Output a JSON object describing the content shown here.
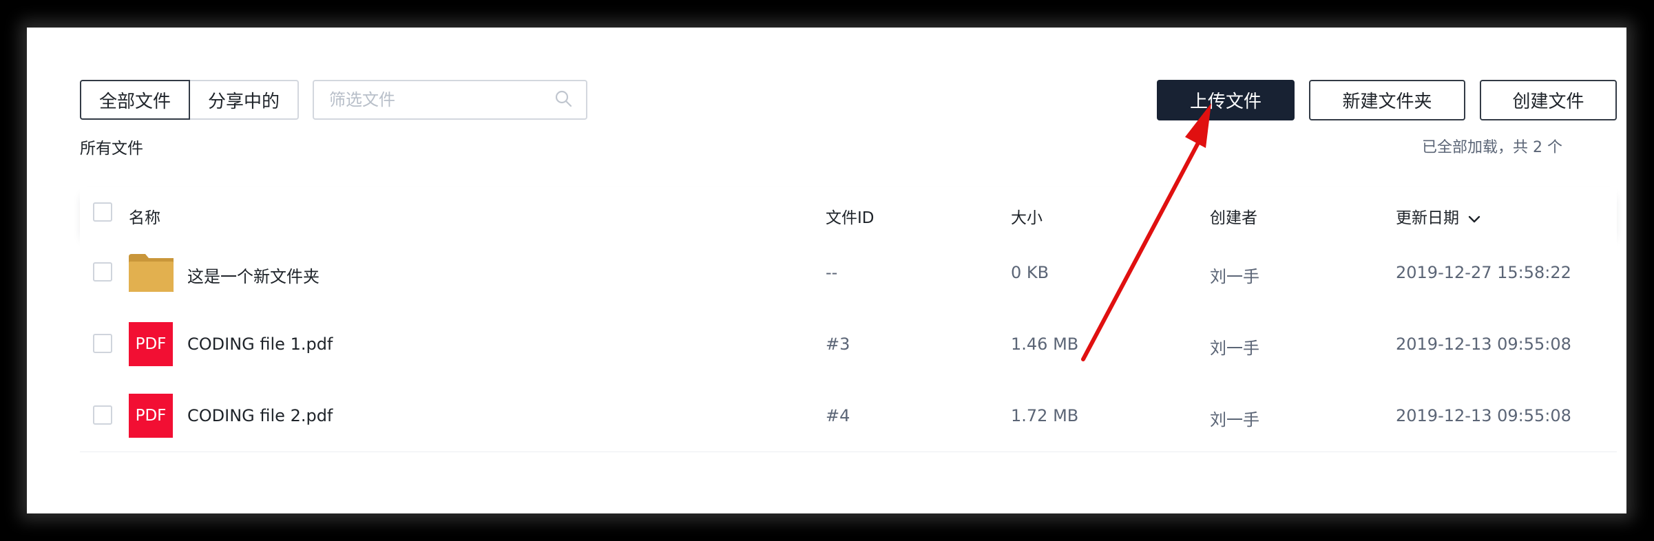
{
  "filter_tabs": {
    "all": "全部文件",
    "sharing": "分享中的"
  },
  "search": {
    "placeholder": "筛选文件"
  },
  "actions": {
    "upload": "上传文件",
    "new_folder": "新建文件夹",
    "create_file": "创建文件"
  },
  "breadcrumb": "所有文件",
  "load_status": "已全部加载，共 2 个",
  "table": {
    "headers": {
      "name": "名称",
      "file_id": "文件ID",
      "size": "大小",
      "creator": "创建者",
      "updated": "更新日期"
    },
    "rows": [
      {
        "type": "folder",
        "name": "这是一个新文件夹",
        "file_id": "--",
        "size": "0 KB",
        "creator": "刘一手",
        "updated": "2019-12-27 15:58:22"
      },
      {
        "type": "pdf",
        "badge": "PDF",
        "name": "CODING file 1.pdf",
        "file_id": "#3",
        "size": "1.46 MB",
        "creator": "刘一手",
        "updated": "2019-12-13 09:55:08"
      },
      {
        "type": "pdf",
        "badge": "PDF",
        "name": "CODING file 2.pdf",
        "file_id": "#4",
        "size": "1.72 MB",
        "creator": "刘一手",
        "updated": "2019-12-13 09:55:08"
      }
    ]
  },
  "colors": {
    "primary_button": "#182233",
    "pdf_badge": "#f20f33",
    "folder": "#e2b04f",
    "annotation_arrow": "#e01010"
  }
}
